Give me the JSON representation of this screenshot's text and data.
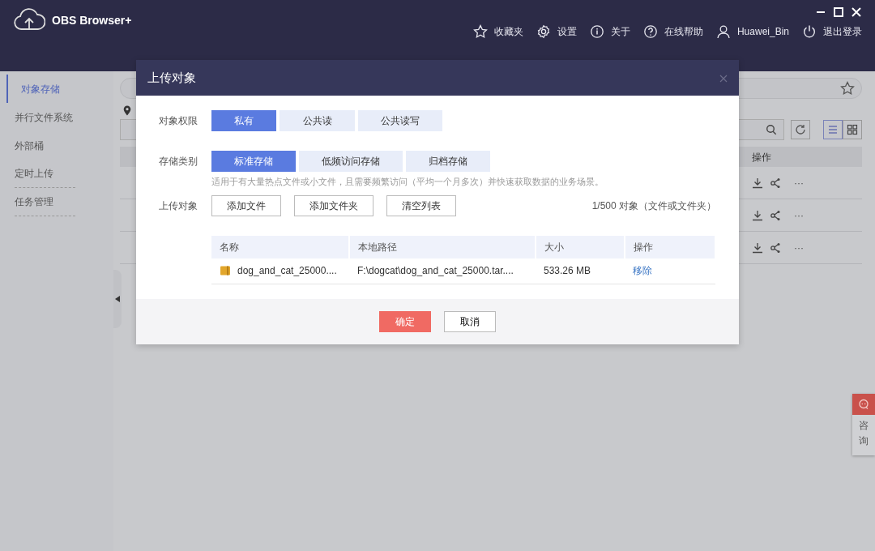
{
  "app": {
    "title": "OBS Browser+"
  },
  "toolbar": [
    {
      "kind": "star",
      "label": "收藏夹"
    },
    {
      "kind": "gear",
      "label": "设置"
    },
    {
      "kind": "info",
      "label": "关于"
    },
    {
      "kind": "help",
      "label": "在线帮助"
    },
    {
      "kind": "user",
      "label": "Huawei_Bin"
    },
    {
      "kind": "power",
      "label": "退出登录"
    }
  ],
  "sidebar": {
    "items": [
      {
        "label": "对象存储",
        "selected": true
      },
      {
        "label": "并行文件系统",
        "selected": false
      },
      {
        "label": "外部桶",
        "selected": false
      },
      {
        "label": "定时上传",
        "selected": false
      },
      {
        "label": "任务管理",
        "selected": false
      }
    ]
  },
  "table": {
    "columns": [
      "操作"
    ],
    "rows": [
      {
        "more": "···"
      },
      {
        "more": "···"
      },
      {
        "more": "···"
      }
    ]
  },
  "dialog": {
    "title": "上传对象",
    "permission": {
      "label": "对象权限",
      "options": [
        {
          "label": "私有",
          "selected": true
        },
        {
          "label": "公共读",
          "selected": false
        },
        {
          "label": "公共读写",
          "selected": false
        }
      ]
    },
    "storage_class": {
      "label": "存储类别",
      "options": [
        {
          "label": "标准存储",
          "selected": true
        },
        {
          "label": "低频访问存储",
          "selected": false
        },
        {
          "label": "归档存储",
          "selected": false
        }
      ],
      "hint": "适用于有大量热点文件或小文件，且需要频繁访问（平均一个月多次）并快速获取数据的业务场景。"
    },
    "upload": {
      "label": "上传对象",
      "buttons": [
        "添加文件",
        "添加文件夹",
        "清空列表"
      ],
      "count": "1/500 对象（文件或文件夹）"
    },
    "files": {
      "columns": [
        "名称",
        "本地路径",
        "大小",
        "操作"
      ],
      "rows": [
        {
          "name": "dog_and_cat_25000....",
          "path": "F:\\dogcat\\dog_and_cat_25000.tar....",
          "size": "533.26 MB",
          "action": "移除"
        }
      ]
    },
    "confirm": "确定",
    "cancel": "取消"
  },
  "consult": {
    "label": "咨询"
  }
}
